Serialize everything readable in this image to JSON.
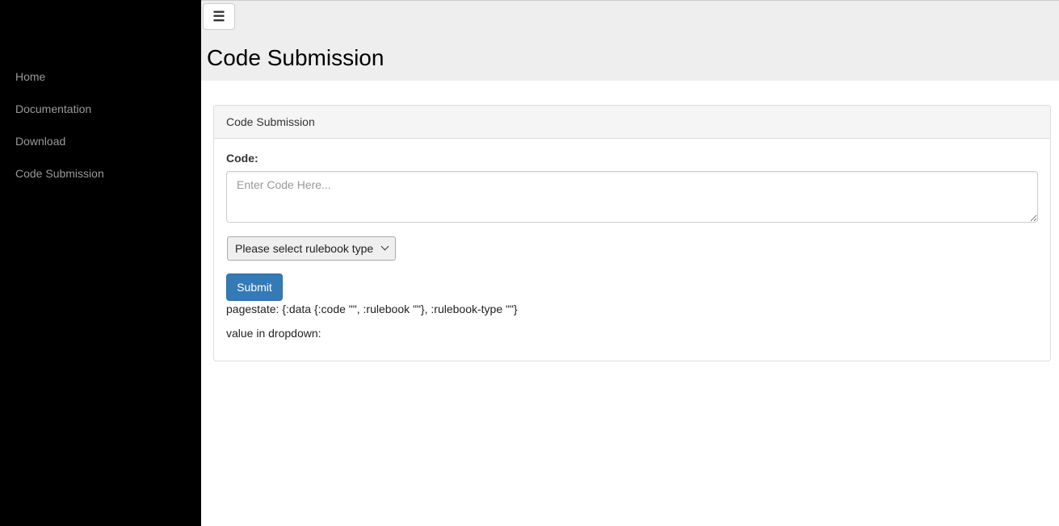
{
  "sidebar": {
    "items": [
      {
        "label": "Home"
      },
      {
        "label": "Documentation"
      },
      {
        "label": "Download"
      },
      {
        "label": "Code Submission"
      }
    ]
  },
  "topbar": {
    "menu_icon": "hamburger-menu-icon",
    "menu_glyph": "☰",
    "title": "Code Submission"
  },
  "panel": {
    "heading": "Code Submission",
    "code_label": "Code:",
    "code_value": "",
    "code_placeholder": "Enter Code Here...",
    "select_value": "Please select rulebook type",
    "submit_label": "Submit",
    "pagestate_text": "pagestate: {:data {:code \"\", :rulebook \"\"}, :rulebook-type \"\"}",
    "dropdown_value_text": "value in dropdown:"
  },
  "colors": {
    "sidebar_bg": "#000000",
    "sidebar_text": "#999999",
    "topbar_bg": "#eeeeee",
    "primary": "#337ab7"
  }
}
